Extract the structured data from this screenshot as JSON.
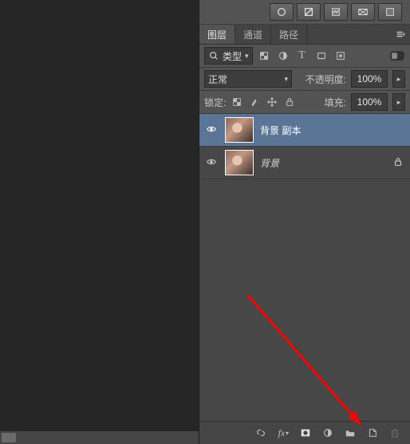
{
  "tabs": {
    "layers": "图层",
    "channels": "通道",
    "paths": "路径"
  },
  "filter": {
    "type_label": "类型"
  },
  "blend": {
    "mode": "正常",
    "opacity_label": "不透明度:",
    "opacity_value": "100%"
  },
  "lock": {
    "label": "锁定:",
    "fill_label": "填充:",
    "fill_value": "100%"
  },
  "layers": [
    {
      "name": "背景 副本",
      "locked": false,
      "selected": true,
      "italic": false
    },
    {
      "name": "背景",
      "locked": true,
      "selected": false,
      "italic": true
    }
  ]
}
